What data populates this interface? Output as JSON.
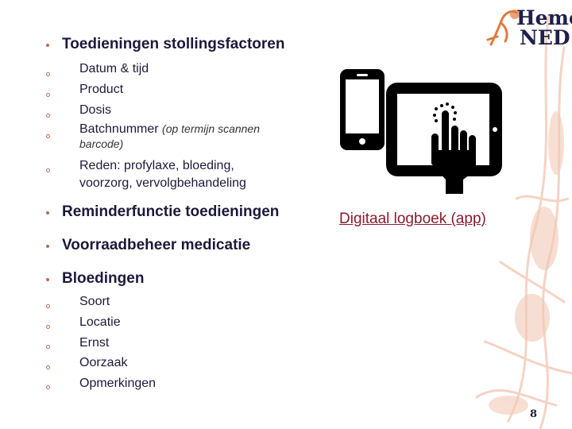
{
  "logo": {
    "line1": "Hemo",
    "line2": "NED",
    "icon": "hemophilia-figure-logo"
  },
  "bullets": [
    {
      "label": "Toedieningen stollingsfactoren",
      "sub": [
        {
          "label": "Datum & tijd"
        },
        {
          "label": "Product"
        },
        {
          "label": "Dosis"
        },
        {
          "label": "Batchnummer",
          "note": "(op termijn scannen barcode)"
        },
        {
          "label": "Reden: profylaxe, bloeding, voorzorg, vervolgbehandeling"
        }
      ]
    },
    {
      "label": "Reminderfunctie toedieningen"
    },
    {
      "label": "Voorraadbeheer medicatie"
    },
    {
      "label": "Bloedingen",
      "sub": [
        {
          "label": "Soort"
        },
        {
          "label": "Locatie"
        },
        {
          "label": "Ernst"
        },
        {
          "label": "Oorzaak"
        },
        {
          "label": "Opmerkingen"
        }
      ]
    }
  ],
  "illustration": {
    "icon": "phone-tablet-touch-icon"
  },
  "link": {
    "label": "Digitaal logboek (app)",
    "color": "#8a1b2e"
  },
  "page_number": "8",
  "colors": {
    "text": "#1c1a3a",
    "bullet": "#b96a4e",
    "decor": "#f2c2ad"
  }
}
